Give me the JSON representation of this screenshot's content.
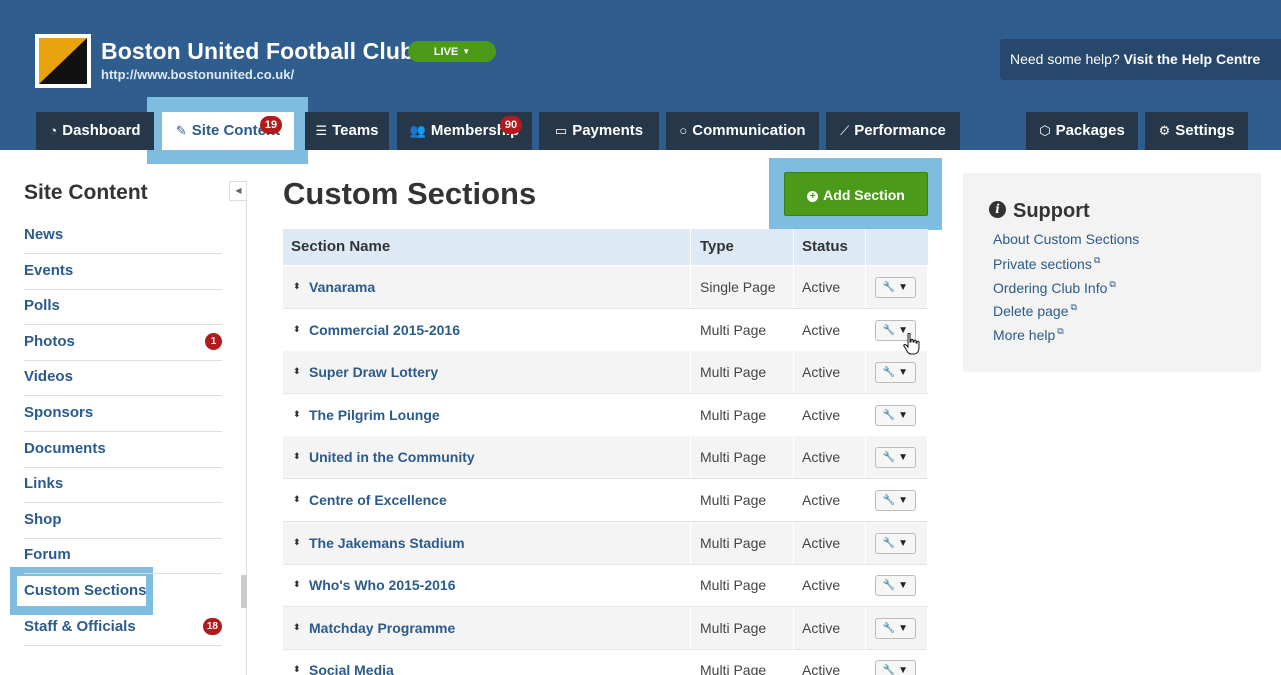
{
  "club": {
    "name": "Boston United Football Club",
    "url": "http://www.bostonunited.co.uk/",
    "live_label": "LIVE",
    "live_caret": "▼"
  },
  "help": {
    "prefix": "Need some help?",
    "link": "Visit the Help Centre"
  },
  "nav": {
    "tabs": [
      {
        "label": "Dashboard",
        "icon": "dashboard-icon",
        "glyph": "◔"
      },
      {
        "label": "Site Content",
        "icon": "pencil-icon",
        "glyph": "✎",
        "badge": "19"
      },
      {
        "label": "Teams",
        "icon": "list-icon",
        "glyph": "☰"
      },
      {
        "label": "Membership",
        "icon": "users-icon",
        "glyph": "👥",
        "badge": "90"
      },
      {
        "label": "Payments",
        "icon": "credit-card-icon",
        "glyph": "▭"
      },
      {
        "label": "Communication",
        "icon": "chat-bubble-icon",
        "glyph": "○"
      },
      {
        "label": "Performance",
        "icon": "line-chart-icon",
        "glyph": "⟋"
      },
      {
        "label": "Packages",
        "icon": "cube-icon",
        "glyph": "⬡"
      },
      {
        "label": "Settings",
        "icon": "gear-icon",
        "glyph": "⚙"
      }
    ]
  },
  "sidebar": {
    "title": "Site Content",
    "collapse_glyph": "◀",
    "items": [
      {
        "label": "News"
      },
      {
        "label": "Events"
      },
      {
        "label": "Polls"
      },
      {
        "label": "Photos",
        "badge": "1"
      },
      {
        "label": "Videos"
      },
      {
        "label": "Sponsors"
      },
      {
        "label": "Documents"
      },
      {
        "label": "Links"
      },
      {
        "label": "Shop"
      },
      {
        "label": "Forum"
      },
      {
        "label": "Custom Sections"
      },
      {
        "label": "Staff & Officials",
        "badge": "18"
      }
    ]
  },
  "main": {
    "title": "Custom Sections",
    "add_button": "Add Section",
    "add_glyph": "+",
    "table": {
      "headers": [
        "Section Name",
        "Type",
        "Status",
        ""
      ],
      "drag_glyph": "⬍",
      "tool_glyph": "🔧 ▼",
      "rows": [
        {
          "name": "Vanarama",
          "type": "Single Page",
          "status": "Active"
        },
        {
          "name": "Commercial 2015-2016",
          "type": "Multi Page",
          "status": "Active"
        },
        {
          "name": "Super Draw Lottery",
          "type": "Multi Page",
          "status": "Active"
        },
        {
          "name": "The Pilgrim Lounge",
          "type": "Multi Page",
          "status": "Active"
        },
        {
          "name": "United in the Community",
          "type": "Multi Page",
          "status": "Active"
        },
        {
          "name": "Centre of Excellence",
          "type": "Multi Page",
          "status": "Active"
        },
        {
          "name": "The Jakemans Stadium",
          "type": "Multi Page",
          "status": "Active"
        },
        {
          "name": "Who's Who 2015-2016",
          "type": "Multi Page",
          "status": "Active"
        },
        {
          "name": "Matchday Programme",
          "type": "Multi Page",
          "status": "Active"
        },
        {
          "name": "Social Media",
          "type": "Multi Page",
          "status": "Active"
        }
      ]
    }
  },
  "support": {
    "title": "Support",
    "info_glyph": "i",
    "ext_glyph": "⧉",
    "links": [
      {
        "label": "About Custom Sections",
        "external": false
      },
      {
        "label": "Private sections",
        "external": true
      },
      {
        "label": "Ordering Club Info",
        "external": true
      },
      {
        "label": "Delete page",
        "external": true
      },
      {
        "label": "More help",
        "external": true
      }
    ]
  },
  "colors": {
    "header_bg": "#2e5d8e",
    "nav_tab_bg": "#26374a",
    "link": "#2b5b8c",
    "accent_green": "#4c9a1a",
    "badge_red": "#b11b1b",
    "highlight": "#7fbde0"
  }
}
